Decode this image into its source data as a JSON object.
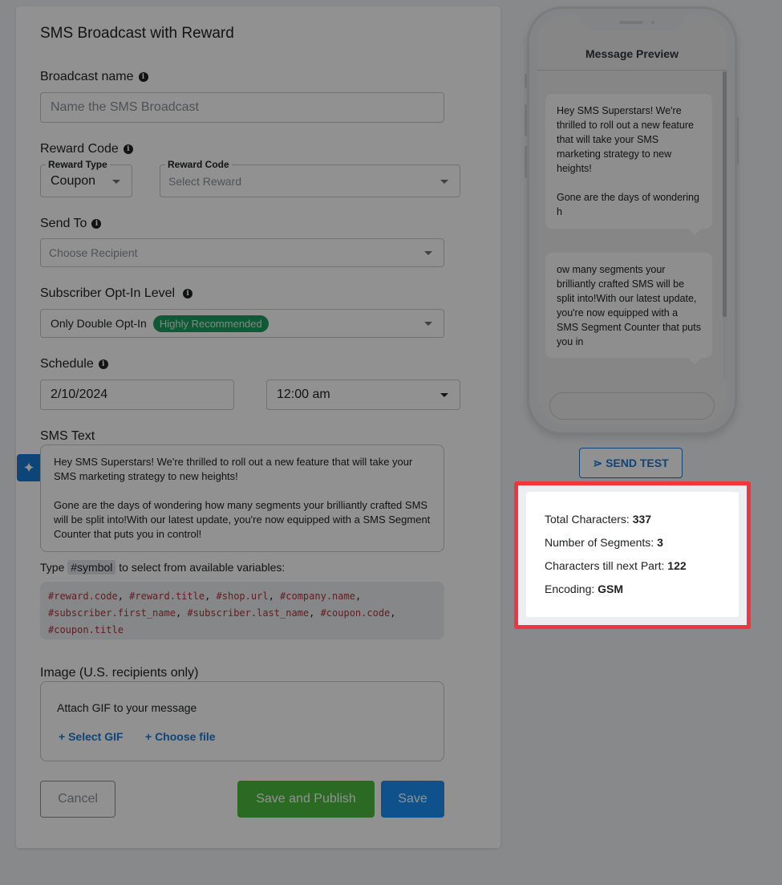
{
  "form": {
    "title": "SMS Broadcast with Reward",
    "broadcast_name": {
      "label": "Broadcast name",
      "value": "",
      "placeholder": "Name the SMS Broadcast"
    },
    "reward_code": {
      "label": "Reward Code",
      "reward_type": {
        "label": "Reward Type",
        "value": "Coupon"
      },
      "reward_select": {
        "label": "Reward Code",
        "placeholder": "Select Reward"
      }
    },
    "send_to": {
      "label": "Send To",
      "placeholder": "Choose Recipient"
    },
    "opt_in": {
      "label": "Subscriber Opt-In Level",
      "value": "Only Double Opt-In",
      "badge": "Highly Recommended",
      "badge_color": "#1f9b5f"
    },
    "schedule": {
      "label": "Schedule",
      "date": "2/10/2024",
      "time": "12:00 am"
    },
    "sms_text": {
      "label": "SMS Text",
      "paragraphs": [
        "Hey SMS Superstars! We're thrilled to roll out a new feature that will take your SMS marketing strategy to new heights!",
        "Gone are the days of wondering how many segments your brilliantly crafted SMS will be split into!With our latest update, you're now equipped with a SMS Segment Counter that puts you in control!"
      ],
      "ai_icon": "sparkles-icon"
    },
    "variables_hint": {
      "prefix": "Type",
      "symbol": "#symbol",
      "suffix": "to select from available variables:"
    },
    "variables": [
      "#reward.code",
      "#reward.title",
      "#shop.url",
      "#company.name",
      "#subscriber.first_name",
      "#subscriber.last_name",
      "#coupon.code",
      "#coupon.title"
    ],
    "image": {
      "label": "Image (U.S. recipients only)",
      "attach_text": "Attach GIF to your message",
      "select_gif": "+ Select GIF",
      "choose_file": "+ Choose file"
    },
    "buttons": {
      "cancel": "Cancel",
      "save_publish": "Save and Publish",
      "save": "Save"
    }
  },
  "preview": {
    "title": "Message Preview",
    "bubbles": [
      {
        "lines": [
          "Hey SMS Superstars! We're thrilled to roll out a new feature that will take your SMS marketing strategy to new heights!",
          "Gone are the days of wondering h"
        ]
      },
      {
        "lines": [
          "ow many segments your brilliantly crafted SMS will be split into!With our latest update, you're now equipped with a SMS Segment Counter that puts you in"
        ]
      }
    ],
    "send_test_label": "SEND TEST",
    "send_test_icon": "send-icon"
  },
  "counter": {
    "total_characters_label": "Total Characters:",
    "total_characters": "337",
    "segments_label": "Number of Segments:",
    "segments": "3",
    "till_next_label": "Characters till next Part:",
    "till_next": "122",
    "encoding_label": "Encoding:",
    "encoding": "GSM"
  },
  "colors": {
    "primary": "#1a8ff5",
    "success": "#4cbb3c",
    "highlight": "#f0353f"
  }
}
